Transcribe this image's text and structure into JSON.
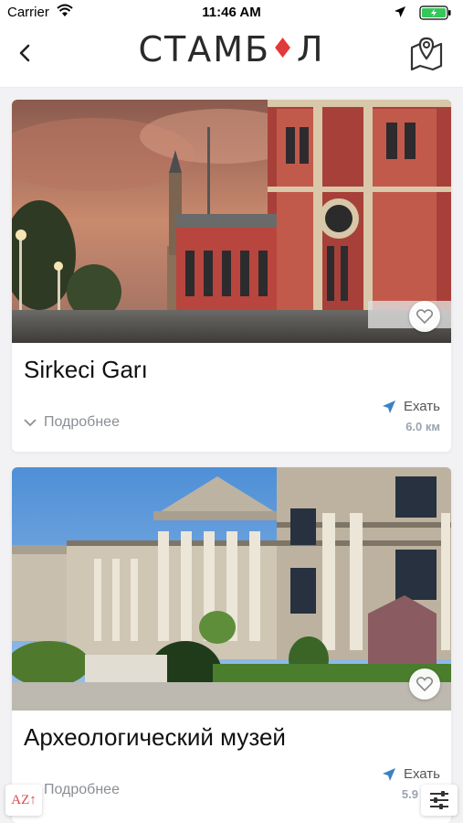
{
  "status": {
    "carrier": "Carrier",
    "time": "11:46 AM"
  },
  "header": {
    "logo_text": "СТАМБ",
    "logo_text_end": "Л",
    "back_icon": "chevron-left-icon",
    "map_icon": "map-pin-icon"
  },
  "places": [
    {
      "title": "Sirkeci Garı",
      "more_label": "Подробнее",
      "go_label": "Ехать",
      "distance": "6.0 км"
    },
    {
      "title": "Археологический музей",
      "more_label": "Подробнее",
      "go_label": "Ехать",
      "distance": "5.9"
    }
  ],
  "controls": {
    "sort_label": "AZ↑",
    "filter_icon": "sliders-icon"
  },
  "colors": {
    "accent": "#3b82c4",
    "tulip": "#e03a3a",
    "muted": "#8a8f96"
  }
}
